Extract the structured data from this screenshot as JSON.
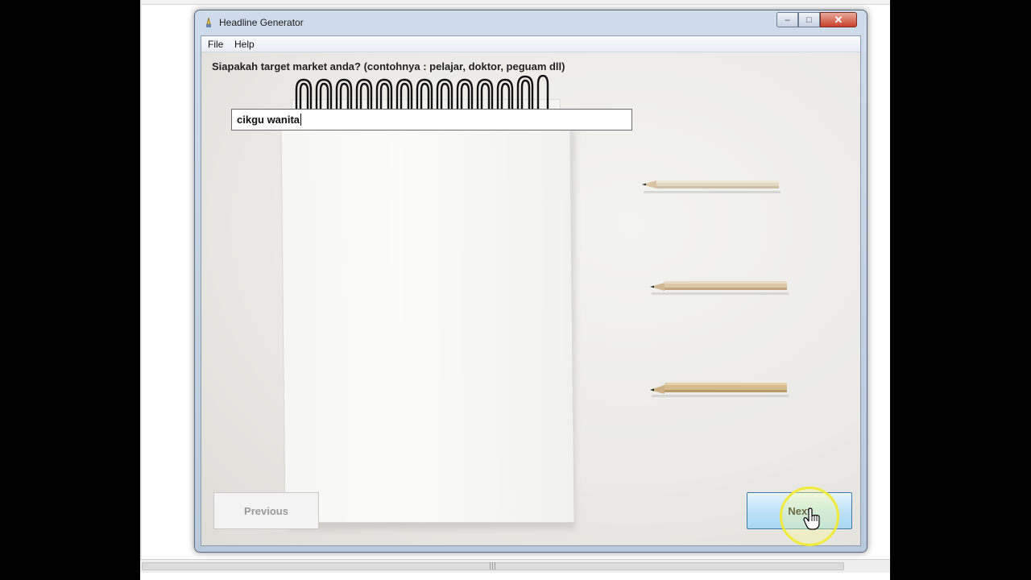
{
  "window": {
    "title": "Headline Generator",
    "controls": {
      "minimize": "–",
      "maximize": "□",
      "close": "✕"
    }
  },
  "menu": {
    "items": [
      "File",
      "Help"
    ]
  },
  "form": {
    "question": "Siapakah target market anda? (contohnya : pelajar, doktor, peguam dll)",
    "answer_value": "cikgu wanita"
  },
  "buttons": {
    "previous": "Previous",
    "next": "Next"
  },
  "icons": [
    "app-icon",
    "minimize-icon",
    "maximize-icon",
    "close-icon",
    "hand-cursor-icon"
  ],
  "colors": {
    "next_button": "#bfe2f8",
    "close_button": "#c7412b",
    "title_bar": "#cfdceb"
  }
}
